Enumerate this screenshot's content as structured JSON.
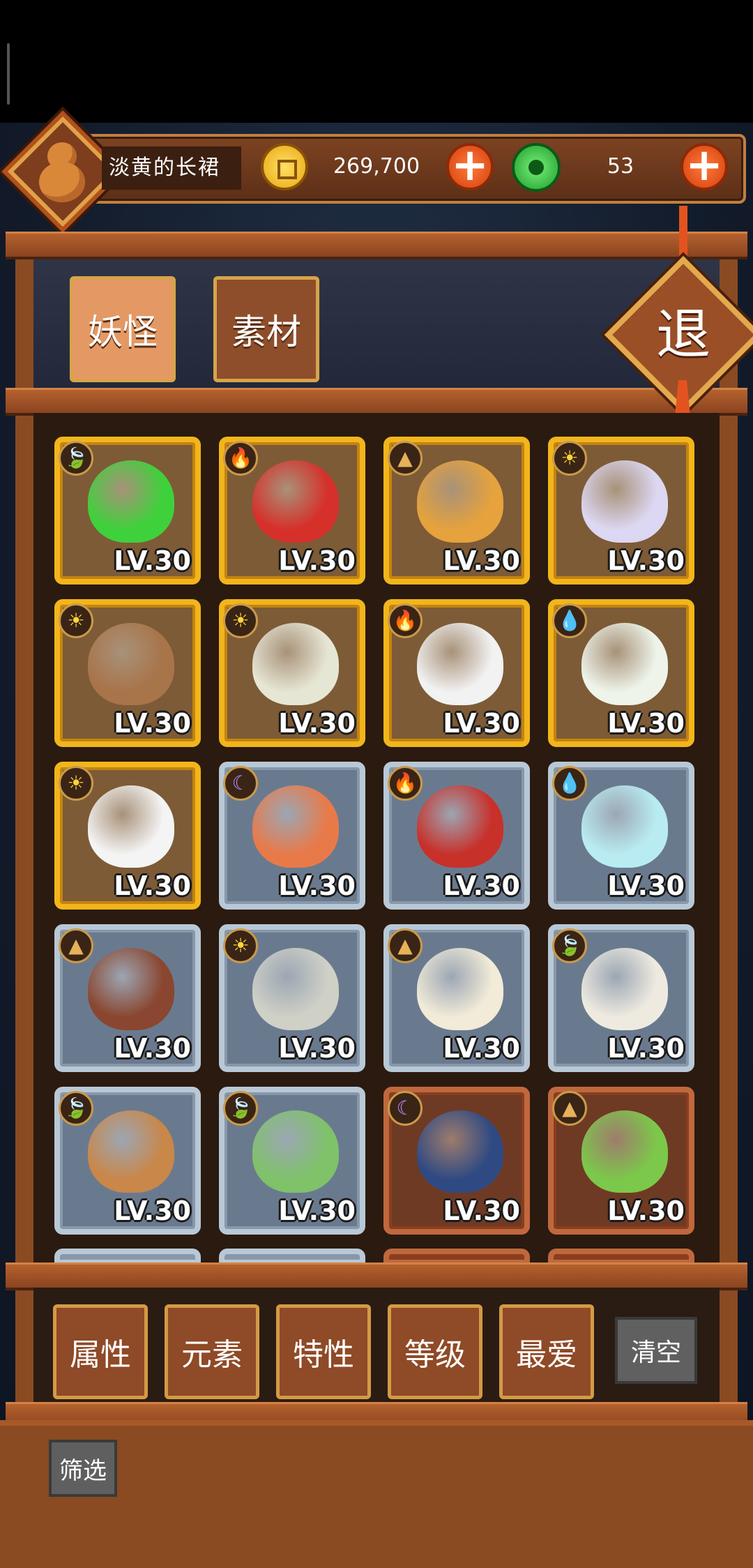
{
  "player": {
    "name": "淡黄的长裙"
  },
  "currency": {
    "gold": "269,700",
    "gems": "53",
    "plus_symbol": "+"
  },
  "tabs": [
    {
      "label": "妖怪",
      "active": true
    },
    {
      "label": "素材",
      "active": false
    }
  ],
  "exit_label": "退",
  "monsters": [
    {
      "level": "LV.30",
      "rarity": "gold",
      "element": "leaf",
      "element_icon": "leaf-icon",
      "creature": "green-star-monster",
      "color": "#3fd13b"
    },
    {
      "level": "LV.30",
      "rarity": "gold",
      "element": "fire",
      "element_icon": "fire-icon",
      "creature": "red-lantern-monster",
      "color": "#d6302a"
    },
    {
      "level": "LV.30",
      "rarity": "gold",
      "element": "earth",
      "element_icon": "earth-icon",
      "creature": "gold-star-monster",
      "color": "#e5a23d"
    },
    {
      "level": "LV.30",
      "rarity": "gold",
      "element": "light",
      "element_icon": "sun-icon",
      "creature": "cloud-fairy-monster",
      "color": "#dcd7f2"
    },
    {
      "level": "LV.30",
      "rarity": "gold",
      "element": "light",
      "element_icon": "sun-icon",
      "creature": "coconut-monster",
      "color": "#a8744a"
    },
    {
      "level": "LV.30",
      "rarity": "gold",
      "element": "light",
      "element_icon": "sun-icon",
      "creature": "milk-tea-monster",
      "color": "#e6e6d4"
    },
    {
      "level": "LV.30",
      "rarity": "gold",
      "element": "fire",
      "element_icon": "fire-icon",
      "creature": "white-cat-monster",
      "color": "#f2f2f2"
    },
    {
      "level": "LV.30",
      "rarity": "gold",
      "element": "water",
      "element_icon": "water-icon",
      "creature": "lotus-baby-monster",
      "color": "#eef4ea"
    },
    {
      "level": "LV.30",
      "rarity": "gold",
      "element": "light",
      "element_icon": "sun-icon",
      "creature": "feather-monster",
      "color": "#f4f4f4"
    },
    {
      "level": "LV.30",
      "rarity": "silver",
      "element": "dark",
      "element_icon": "moon-icon",
      "creature": "sushi-monster",
      "color": "#e87a4a"
    },
    {
      "level": "LV.30",
      "rarity": "silver",
      "element": "fire",
      "element_icon": "fire-icon",
      "creature": "red-flame-monster",
      "color": "#c8302a"
    },
    {
      "level": "LV.30",
      "rarity": "silver",
      "element": "water",
      "element_icon": "water-icon",
      "creature": "ghost-flower-monster",
      "color": "#b9ecf2"
    },
    {
      "level": "LV.30",
      "rarity": "silver",
      "element": "earth",
      "element_icon": "earth-icon",
      "creature": "bell-monster",
      "color": "#8a4630"
    },
    {
      "level": "LV.30",
      "rarity": "silver",
      "element": "light",
      "element_icon": "sun-icon",
      "creature": "stone-hippo-monster",
      "color": "#cfd0c6"
    },
    {
      "level": "LV.30",
      "rarity": "silver",
      "element": "earth",
      "element_icon": "earth-icon",
      "creature": "paper-box-monster",
      "color": "#f1ebd8"
    },
    {
      "level": "LV.30",
      "rarity": "silver",
      "element": "leaf",
      "element_icon": "leaf-icon",
      "creature": "wooden-horse-monster",
      "color": "#eeeae0"
    },
    {
      "level": "LV.30",
      "rarity": "silver",
      "element": "leaf",
      "element_icon": "leaf-icon",
      "creature": "sprout-root-monster",
      "color": "#c9874a"
    },
    {
      "level": "LV.30",
      "rarity": "silver",
      "element": "leaf",
      "element_icon": "leaf-icon",
      "creature": "leaf-girl-monster",
      "color": "#7fc26a"
    },
    {
      "level": "LV.30",
      "rarity": "bronze",
      "element": "dark",
      "element_icon": "moon-icon",
      "creature": "swallow-monster",
      "color": "#2f4a82"
    },
    {
      "level": "LV.30",
      "rarity": "bronze",
      "element": "earth",
      "element_icon": "earth-icon",
      "creature": "ramen-bowl-monster",
      "color": "#7cc84a"
    }
  ],
  "filters": [
    {
      "label": "属性"
    },
    {
      "label": "元素"
    },
    {
      "label": "特性"
    },
    {
      "label": "等级"
    },
    {
      "label": "最爱"
    }
  ],
  "clear_label": "清空",
  "screen_label": "筛选"
}
